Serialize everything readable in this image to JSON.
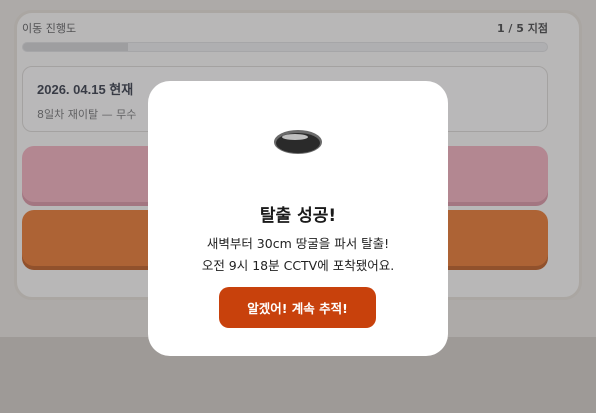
{
  "progress": {
    "label": "이동 진행도",
    "count": "1 / 5 지점",
    "fraction": 0.2
  },
  "info": {
    "date": "2026. 04.15 현재",
    "description": "8일차 재이탈 — 무수"
  },
  "modal": {
    "icon": "hole-icon",
    "title": "탈출 성공!",
    "line1": "새벽부터 30cm 땅굴을 파서 탈출!",
    "line2": "오전 9시 18분 CCTV에 포착됐어요.",
    "confirm_label": "알겠어! 계속 추적!"
  },
  "colors": {
    "accent": "#c8410c",
    "pink_button": "#f3a7b6",
    "orange_button": "#e86a17"
  }
}
